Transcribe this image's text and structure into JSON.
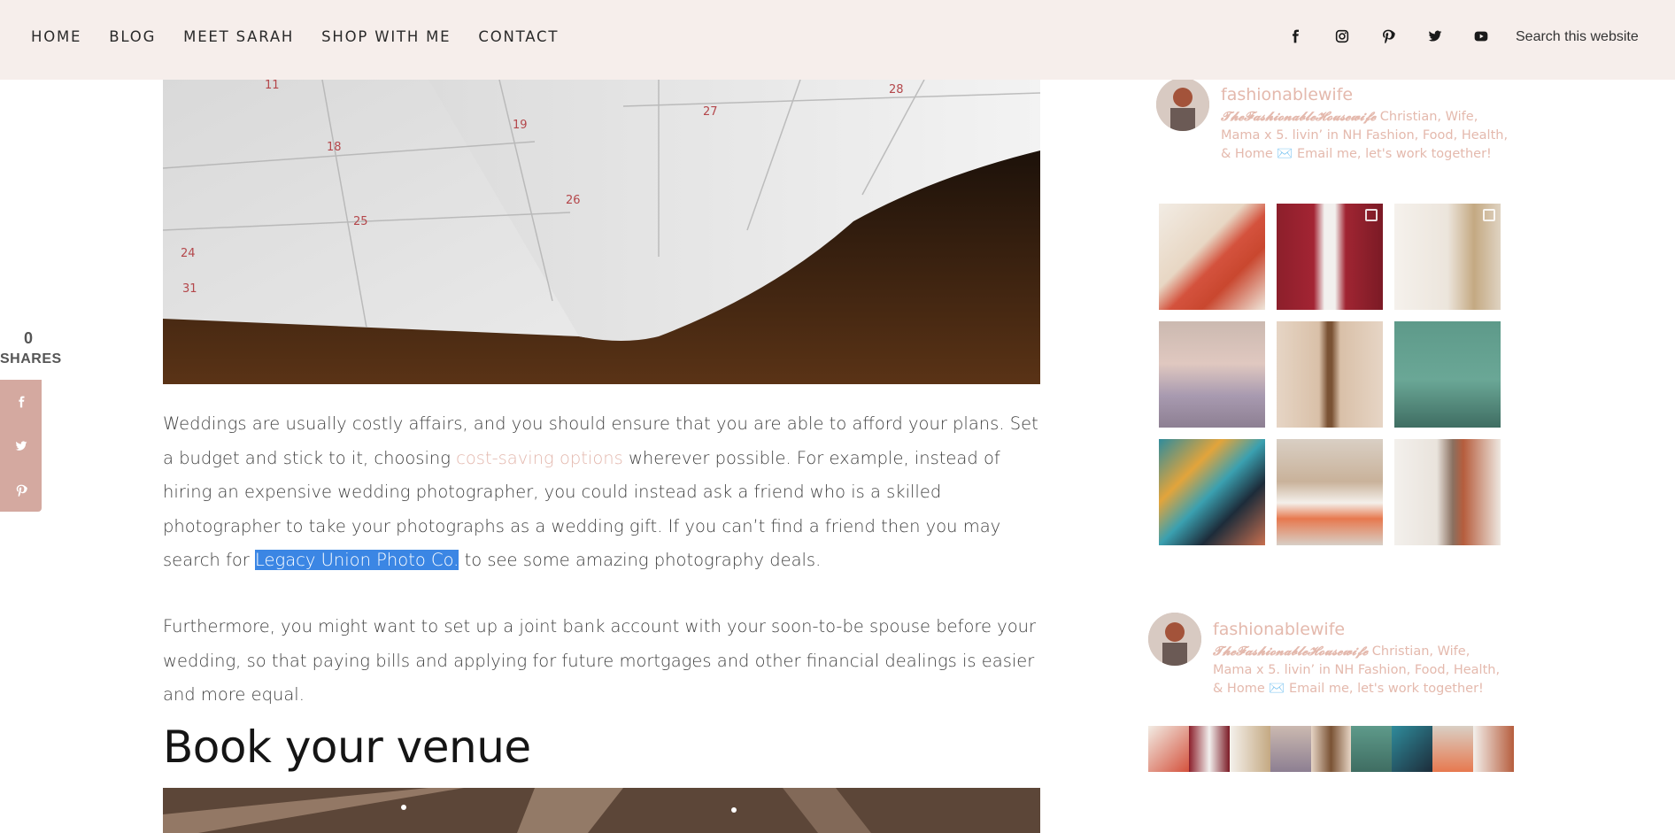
{
  "nav": {
    "items": [
      "HOME",
      "BLOG",
      "MEET SARAH",
      "SHOP WITH ME",
      "CONTACT"
    ]
  },
  "social": {
    "icons": [
      "facebook-icon",
      "instagram-icon",
      "pinterest-icon",
      "twitter-icon",
      "youtube-icon"
    ]
  },
  "search": {
    "placeholder": "Search this website"
  },
  "share": {
    "count": "0",
    "label": "SHARES",
    "buttons": [
      "facebook-icon",
      "twitter-icon",
      "pinterest-icon"
    ]
  },
  "article": {
    "p1_a": "Weddings are usually costly affairs, and you should ensure that you are able to afford your plans. Set a budget and stick to it, choosing ",
    "p1_link": "cost-saving options",
    "p1_b": " wherever possible. For example, instead of hiring an expensive wedding photographer, you could instead ask a friend who is a skilled photographer to take your photographs as a wedding gift. If you can’t find a friend then you may search for ",
    "p1_hl": "Legacy Union Photo Co.",
    "p1_c": " to see some amazing photography deals.",
    "p2": "Furthermore, you might want to set up a joint bank account with your soon-to-be spouse before your wedding, so that paying bills and applying for future mortgages and other financial dealings is easier and more equal.",
    "heading": "Book your venue"
  },
  "instagram": {
    "username": "fashionablewife",
    "bio_script": "𝓣𝓱𝓮𝓕𝓪𝓼𝓱𝓲𝓸𝓷𝓪𝓫𝓵𝓮𝓗𝓸𝓾𝓼𝓮𝔀𝓲𝓯𝓮",
    "bio_text": " Christian, Wife, Mama x 5. livin’ in NH Fashion, Food, Health, & Home ✉️ Email me, let's work together!"
  },
  "colors": {
    "header_bg": "#f6eeeb",
    "accent": "#e4b9ad",
    "share_bg": "#d4a9a0",
    "highlight": "#3b86e4"
  }
}
